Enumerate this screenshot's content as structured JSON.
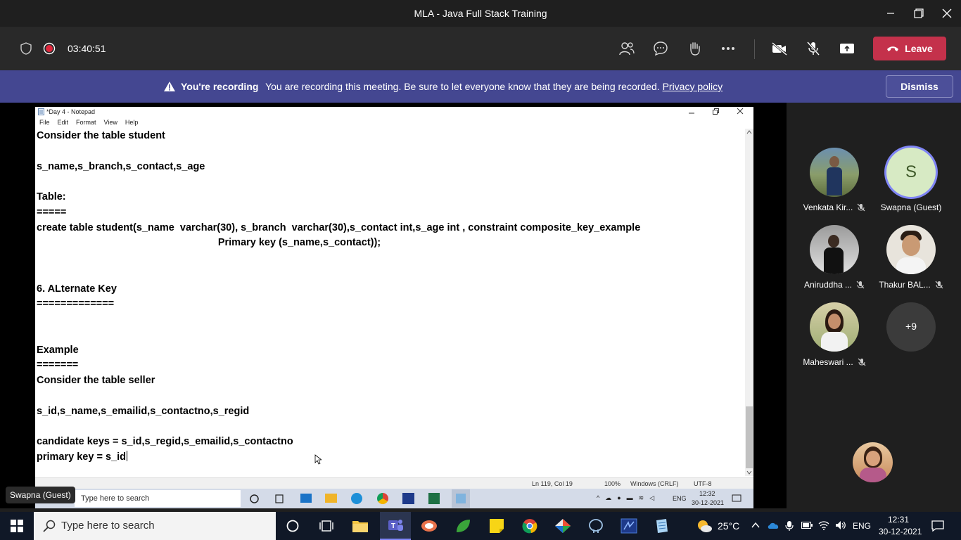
{
  "window": {
    "title": "MLA - Java Full Stack Training"
  },
  "meeting": {
    "timer": "03:40:51",
    "leave_label": "Leave"
  },
  "banner": {
    "headline": "You're recording",
    "message": "You are recording this meeting. Be sure to let everyone know that they are being recorded.",
    "link": "Privacy policy",
    "dismiss_label": "Dismiss"
  },
  "notepad": {
    "title": "*Day 4 - Notepad",
    "menu": [
      "File",
      "Edit",
      "Format",
      "View",
      "Help"
    ],
    "lines": [
      "Consider the table student",
      "",
      "s_name,s_branch,s_contact,s_age",
      "",
      "Table:",
      "=====",
      "create table student(s_name  varchar(30), s_branch  varchar(30),s_contact int,s_age int , constraint composite_key_example",
      "                                                                Primary key (s_name,s_contact));",
      "",
      "",
      "6. ALternate Key",
      "=============",
      "",
      "",
      "Example",
      "=======",
      "Consider the table seller",
      "",
      "s_id,s_name,s_emailid,s_contactno,s_regid",
      "",
      "candidate keys = s_id,s_regid,s_emailid,s_contactno",
      "primary key = s_id"
    ],
    "status": {
      "position": "Ln 119, Col 19",
      "zoom": "100%",
      "eol": "Windows (CRLF)",
      "encoding": "UTF-8"
    }
  },
  "inner_taskbar": {
    "search_placeholder": "Type here to search",
    "time": "12:32",
    "date": "30-12-2021",
    "lang": "ENG"
  },
  "presenter_label": "Swapna (Guest)",
  "participants": [
    {
      "name": "Venkata Kir...",
      "muted": true
    },
    {
      "name": "Swapna (Guest)",
      "initial": "S",
      "muted": false
    },
    {
      "name": "Aniruddha ...",
      "muted": true
    },
    {
      "name": "Thakur BAL...",
      "muted": true
    },
    {
      "name": "Maheswari ...",
      "muted": true
    },
    {
      "name": "",
      "more": "+9"
    }
  ],
  "taskbar": {
    "search_placeholder": "Type here to search",
    "weather": "25°C",
    "lang": "ENG",
    "time": "12:31",
    "date": "30-12-2021"
  },
  "colors": {
    "banner": "#444791",
    "leave": "#c4314b",
    "taskbar": "#101827"
  }
}
